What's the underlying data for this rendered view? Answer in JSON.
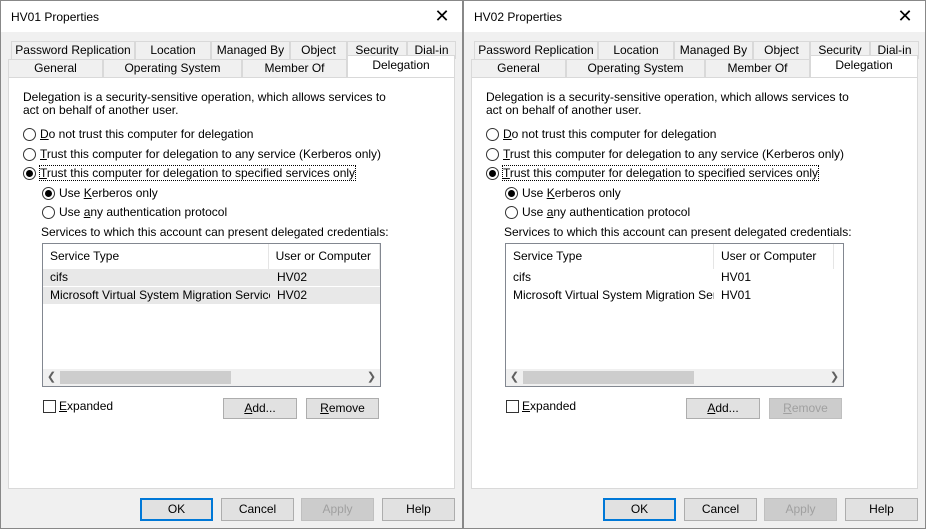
{
  "dialogs": [
    {
      "title": "HV01 Properties",
      "tabs_back": [
        "Password Replication",
        "Location",
        "Managed By",
        "Object",
        "Security",
        "Dial-in"
      ],
      "tabs_front": [
        "General",
        "Operating System",
        "Member Of",
        "Delegation"
      ],
      "selected_tab": "Delegation",
      "description": "Delegation is a security-sensitive operation, which allows services to act on behalf of another user.",
      "options": [
        {
          "pre": "",
          "key": "D",
          "post": "o not trust this computer for delegation",
          "selected": false
        },
        {
          "pre": "",
          "key": "T",
          "post": "rust this computer for delegation to any service (Kerberos only)",
          "selected": false
        },
        {
          "pre": "",
          "key": "T",
          "post": "rust this computer for delegation to specified services only",
          "selected": true
        }
      ],
      "sub_options": [
        {
          "pre": "Use ",
          "key": "K",
          "post": "erberos only",
          "selected": true
        },
        {
          "pre": "Use ",
          "key": "a",
          "post": "ny authentication protocol",
          "selected": false
        }
      ],
      "list_caption": "Services to which this account can present delegated credentials:",
      "columns": [
        "Service Type",
        "User or Computer"
      ],
      "rows": [
        {
          "service": "cifs",
          "user": "HV02"
        },
        {
          "service": "Microsoft Virtual System Migration Service",
          "user": "HV02"
        }
      ],
      "rows_highlighted": true,
      "expanded_label": "Expanded",
      "expanded_key": "E",
      "expanded_rest": "xpanded",
      "add_key": "A",
      "add_rest": "dd...",
      "remove_label": "Remove",
      "remove_key": "R",
      "remove_rest": "emove",
      "remove_enabled": true,
      "footer": {
        "ok": "OK",
        "cancel": "Cancel",
        "apply": "Apply",
        "help": "Help"
      }
    },
    {
      "title": "HV02 Properties",
      "tabs_back": [
        "Password Replication",
        "Location",
        "Managed By",
        "Object",
        "Security",
        "Dial-in"
      ],
      "tabs_front": [
        "General",
        "Operating System",
        "Member Of",
        "Delegation"
      ],
      "selected_tab": "Delegation",
      "description": "Delegation is a security-sensitive operation, which allows services to act on behalf of another user.",
      "options": [
        {
          "pre": "",
          "key": "D",
          "post": "o not trust this computer for delegation",
          "selected": false
        },
        {
          "pre": "",
          "key": "T",
          "post": "rust this computer for delegation to any service (Kerberos only)",
          "selected": false
        },
        {
          "pre": "",
          "key": "T",
          "post": "rust this computer for delegation to specified services only",
          "selected": true
        }
      ],
      "sub_options": [
        {
          "pre": "Use ",
          "key": "K",
          "post": "erberos only",
          "selected": true
        },
        {
          "pre": "Use ",
          "key": "a",
          "post": "ny authentication protocol",
          "selected": false
        }
      ],
      "list_caption": "Services to which this account can present delegated credentials:",
      "columns": [
        "Service Type",
        "User or Computer"
      ],
      "rows": [
        {
          "service": "cifs",
          "user": "HV01"
        },
        {
          "service": "Microsoft Virtual System Migration Service",
          "user": "HV01"
        }
      ],
      "rows_highlighted": false,
      "expanded_label": "Expanded",
      "expanded_key": "E",
      "expanded_rest": "xpanded",
      "add_key": "A",
      "add_rest": "dd...",
      "remove_label": "Remove",
      "remove_key": "R",
      "remove_rest": "emove",
      "remove_enabled": false,
      "footer": {
        "ok": "OK",
        "cancel": "Cancel",
        "apply": "Apply",
        "help": "Help"
      }
    }
  ],
  "icons": {
    "close": "close-icon",
    "scroll_left": "chevron-left-icon",
    "scroll_right": "chevron-right-icon"
  },
  "colors": {
    "focus_blue": "#0078d7",
    "dialog_bg": "#f0f0f0",
    "row_highlight": "#e8e8e8"
  }
}
